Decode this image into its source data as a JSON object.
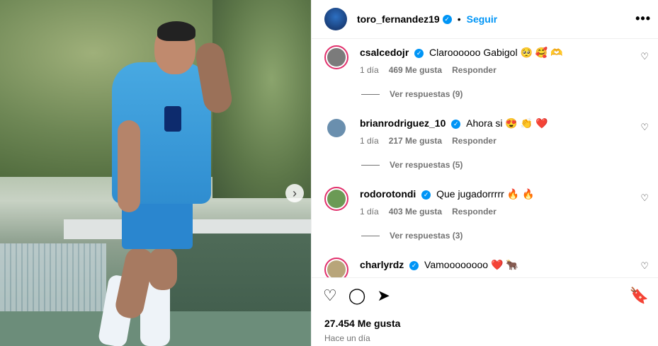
{
  "post": {
    "author": "toro_fernandez19",
    "follow_label": "Seguir",
    "more_icon": "•••",
    "likes_label": "27.454 Me gusta",
    "time_label": "Hace un día"
  },
  "comments": [
    {
      "user": "csalcedojr",
      "text": "Claroooooo Gabigol",
      "emoji": "🥺 🥰 🫶",
      "age": "1 día",
      "likes": "469 Me gusta",
      "reply": "Responder",
      "replies": "Ver respuestas (9)",
      "avatar_color": "#7b7b7b"
    },
    {
      "user": "brianrodriguez_10",
      "text": "Ahora si",
      "emoji": "😍 👏 ❤️",
      "age": "1 día",
      "likes": "217 Me gusta",
      "reply": "Responder",
      "replies": "Ver respuestas (5)",
      "avatar_color": "#6a8fae"
    },
    {
      "user": "rodorotondi",
      "text": "Que jugadorrrrr",
      "emoji": "🔥 🔥",
      "age": "1 día",
      "likes": "403 Me gusta",
      "reply": "Responder",
      "replies": "Ver respuestas (3)",
      "avatar_color": "#6b9a55"
    },
    {
      "user": "charlyrdz",
      "text": "Vamoooooooo",
      "emoji": "❤️ 🐂",
      "age": "",
      "likes": "",
      "reply": "",
      "replies": "",
      "avatar_color": "#b8a57a"
    }
  ],
  "icons": {
    "heart": "♡",
    "comment": "◯",
    "share": "➤",
    "bookmark": "🔖",
    "next": "›"
  }
}
